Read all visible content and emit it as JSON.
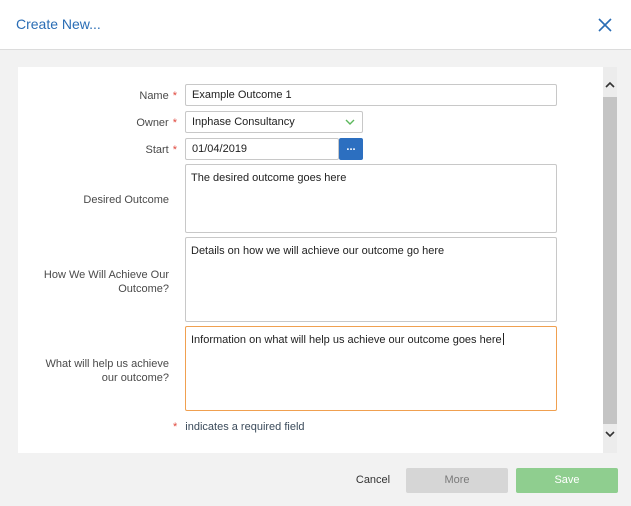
{
  "dialog": {
    "title": "Create New..."
  },
  "form": {
    "name": {
      "label": "Name",
      "required_mark": "*",
      "value": "Example Outcome 1"
    },
    "owner": {
      "label": "Owner",
      "required_mark": "*",
      "value": "Inphase Consultancy"
    },
    "start": {
      "label": "Start",
      "required_mark": "*",
      "value": "01/04/2019",
      "picker_label": "..."
    },
    "desired_outcome": {
      "label": "Desired Outcome",
      "value": "The desired outcome goes here"
    },
    "how_achieve": {
      "label_line1": "How We Will Achieve Our",
      "label_line2": "Outcome?",
      "value": "Details on how we will achieve our outcome go here"
    },
    "what_help": {
      "label_line1": "What will help us achieve",
      "label_line2": "our outcome?",
      "value": "Information on what will help us achieve our outcome goes here"
    },
    "required_note": {
      "star": "*",
      "text": "indicates a required field"
    }
  },
  "footer": {
    "cancel_label": "Cancel",
    "more_label": "More",
    "save_label": "Save"
  },
  "colors": {
    "accent": "#2a6db5",
    "required": "#e0483e",
    "save_bg": "#8fce8f",
    "more_bg": "#d6d6d6",
    "focus_border": "#f0a050",
    "select_chevron": "#5cb85c"
  },
  "icons": {
    "close": "close-icon",
    "select_chevron": "chevron-down-icon",
    "scroll_up": "chevron-up-icon",
    "scroll_down": "chevron-down-icon"
  }
}
